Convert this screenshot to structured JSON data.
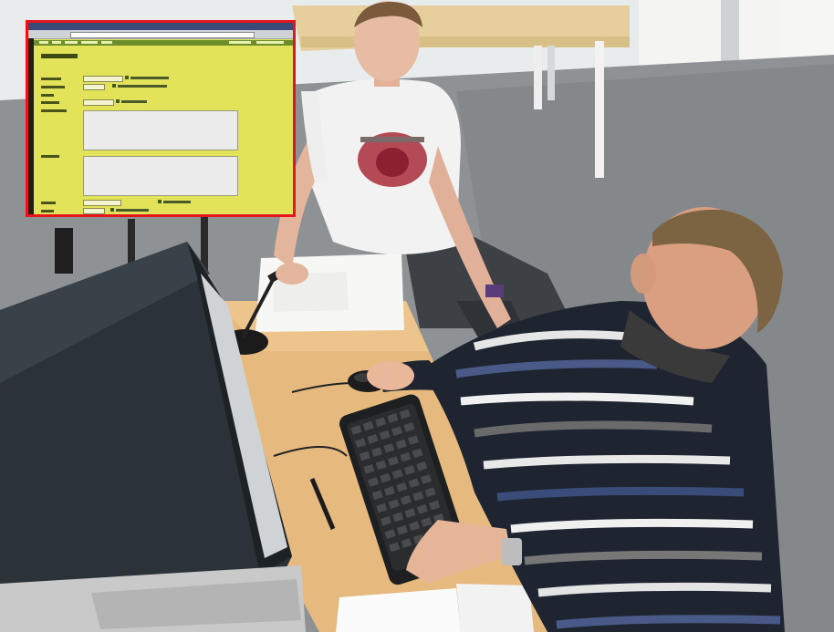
{
  "scene": {
    "description_visible_text": [],
    "overlay_border_color": "#e8141b",
    "overlay_bg_color": "#e3e35a"
  }
}
